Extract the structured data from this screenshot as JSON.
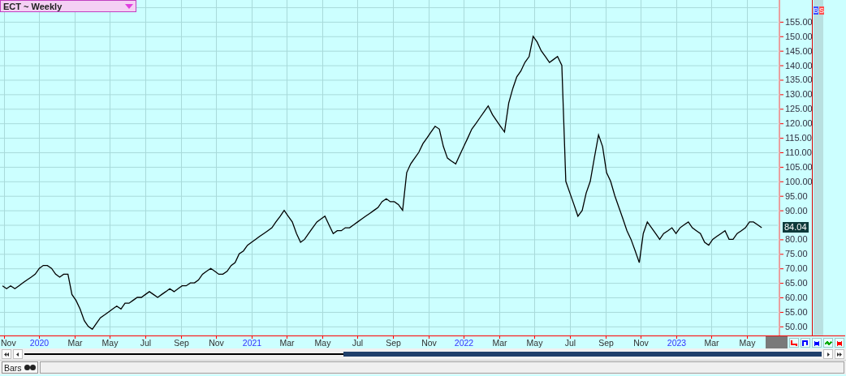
{
  "title_selector": {
    "label": "ECT ~ Weekly"
  },
  "chart": {
    "last_price": "84.04",
    "side_buttons": [
      {
        "label": "B",
        "kind": "buy"
      },
      {
        "label": "S",
        "kind": "sell"
      }
    ],
    "chart_data": {
      "type": "line",
      "grid": true,
      "ylim": [
        46.6,
        162.5
      ],
      "xlim": [
        2019.815,
        2023.801
      ],
      "yticks": [
        {
          "value": 50,
          "label": "50.00"
        },
        {
          "value": 55,
          "label": "55.00"
        },
        {
          "value": 60,
          "label": "60.00"
        },
        {
          "value": 65,
          "label": "65.00"
        },
        {
          "value": 70,
          "label": "70.00"
        },
        {
          "value": 75,
          "label": "75.00"
        },
        {
          "value": 80,
          "label": "80.00"
        },
        {
          "value": 90,
          "label": "90.00"
        },
        {
          "value": 95,
          "label": "95.00"
        },
        {
          "value": 100,
          "label": "100.00"
        },
        {
          "value": 105,
          "label": "105.00"
        },
        {
          "value": 110,
          "label": "110.00"
        },
        {
          "value": 115,
          "label": "115.00"
        },
        {
          "value": 120,
          "label": "120.00"
        },
        {
          "value": 125,
          "label": "125.00"
        },
        {
          "value": 130,
          "label": "130.00"
        },
        {
          "value": 135,
          "label": "135.00"
        },
        {
          "value": 140,
          "label": "140.00"
        },
        {
          "value": 145,
          "label": "145.00"
        },
        {
          "value": 150,
          "label": "150.00"
        },
        {
          "value": 155,
          "label": "155.00"
        }
      ],
      "xticks": [
        {
          "value": 2019.833,
          "label": "Nov"
        },
        {
          "value": 2020,
          "label": "2020"
        },
        {
          "value": 2020.167,
          "label": "Mar"
        },
        {
          "value": 2020.333,
          "label": "May"
        },
        {
          "value": 2020.5,
          "label": "Jul"
        },
        {
          "value": 2020.667,
          "label": "Sep"
        },
        {
          "value": 2020.833,
          "label": "Nov"
        },
        {
          "value": 2021,
          "label": "2021"
        },
        {
          "value": 2021.167,
          "label": "Mar"
        },
        {
          "value": 2021.333,
          "label": "May"
        },
        {
          "value": 2021.5,
          "label": "Jul"
        },
        {
          "value": 2021.667,
          "label": "Sep"
        },
        {
          "value": 2021.833,
          "label": "Nov"
        },
        {
          "value": 2022,
          "label": "2022"
        },
        {
          "value": 2022.167,
          "label": "Mar"
        },
        {
          "value": 2022.333,
          "label": "May"
        },
        {
          "value": 2022.5,
          "label": "Jul"
        },
        {
          "value": 2022.667,
          "label": "Sep"
        },
        {
          "value": 2022.833,
          "label": "Nov"
        },
        {
          "value": 2023,
          "label": "2023"
        },
        {
          "value": 2023.167,
          "label": "Mar"
        },
        {
          "value": 2023.333,
          "label": "May"
        }
      ],
      "x": [
        2019.827,
        2019.846,
        2019.865,
        2019.885,
        2019.904,
        2019.923,
        2019.942,
        2019.962,
        2019.981,
        2020.0,
        2020.019,
        2020.038,
        2020.058,
        2020.077,
        2020.096,
        2020.115,
        2020.135,
        2020.154,
        2020.173,
        2020.192,
        2020.212,
        2020.231,
        2020.25,
        2020.269,
        2020.288,
        2020.308,
        2020.327,
        2020.346,
        2020.365,
        2020.385,
        2020.404,
        2020.423,
        2020.442,
        2020.462,
        2020.481,
        2020.5,
        2020.519,
        2020.538,
        2020.558,
        2020.577,
        2020.596,
        2020.615,
        2020.635,
        2020.654,
        2020.673,
        2020.692,
        2020.712,
        2020.731,
        2020.75,
        2020.769,
        2020.788,
        2020.808,
        2020.827,
        2020.846,
        2020.865,
        2020.885,
        2020.904,
        2020.923,
        2020.942,
        2020.962,
        2020.981,
        2021.0,
        2021.019,
        2021.038,
        2021.058,
        2021.077,
        2021.096,
        2021.115,
        2021.135,
        2021.154,
        2021.173,
        2021.192,
        2021.212,
        2021.231,
        2021.25,
        2021.269,
        2021.288,
        2021.308,
        2021.327,
        2021.346,
        2021.365,
        2021.385,
        2021.404,
        2021.423,
        2021.442,
        2021.462,
        2021.481,
        2021.5,
        2021.519,
        2021.538,
        2021.558,
        2021.577,
        2021.596,
        2021.615,
        2021.635,
        2021.654,
        2021.673,
        2021.692,
        2021.712,
        2021.731,
        2021.75,
        2021.769,
        2021.788,
        2021.808,
        2021.827,
        2021.846,
        2021.865,
        2021.885,
        2021.904,
        2021.923,
        2021.942,
        2021.962,
        2021.981,
        2022.0,
        2022.019,
        2022.038,
        2022.058,
        2022.077,
        2022.096,
        2022.115,
        2022.135,
        2022.154,
        2022.173,
        2022.192,
        2022.212,
        2022.231,
        2022.25,
        2022.269,
        2022.288,
        2022.308,
        2022.327,
        2022.346,
        2022.365,
        2022.385,
        2022.404,
        2022.423,
        2022.442,
        2022.462,
        2022.481,
        2022.5,
        2022.519,
        2022.538,
        2022.558,
        2022.577,
        2022.596,
        2022.615,
        2022.635,
        2022.654,
        2022.673,
        2022.692,
        2022.712,
        2022.731,
        2022.75,
        2022.769,
        2022.788,
        2022.808,
        2022.827,
        2022.846,
        2022.865,
        2022.885,
        2022.904,
        2022.923,
        2022.942,
        2022.962,
        2022.981,
        2023.0,
        2023.019,
        2023.038,
        2023.058,
        2023.077,
        2023.096,
        2023.115,
        2023.135,
        2023.154,
        2023.173,
        2023.192,
        2023.212,
        2023.231,
        2023.25,
        2023.269,
        2023.288,
        2023.308,
        2023.327,
        2023.346,
        2023.365,
        2023.385,
        2023.404
      ],
      "series": [
        {
          "color": "#000000",
          "values": [
            64,
            63,
            64,
            63,
            64,
            65,
            66,
            67,
            68,
            70,
            71,
            71,
            70,
            68,
            67,
            68,
            68,
            61,
            59,
            56,
            52,
            50,
            49,
            51,
            53,
            54,
            55,
            56,
            57,
            56,
            58,
            58,
            59,
            60,
            60,
            61,
            62,
            61,
            60,
            61,
            62,
            63,
            62,
            63,
            64,
            64,
            65,
            65,
            66,
            68,
            69,
            70,
            69,
            68,
            68,
            69,
            71,
            72,
            75,
            76,
            78,
            79,
            80,
            81,
            82,
            83,
            84,
            86,
            88,
            90,
            88,
            86,
            82,
            79,
            80,
            82,
            84,
            86,
            87,
            88,
            85,
            82,
            83,
            83,
            84,
            84,
            85,
            86,
            87,
            88,
            89,
            90,
            91,
            93,
            94,
            93,
            93,
            92,
            90,
            103,
            106,
            108,
            110,
            113,
            115,
            117,
            119,
            118,
            112,
            108,
            107,
            106,
            109,
            112,
            115,
            118,
            120,
            122,
            124,
            126,
            123,
            121,
            119,
            117,
            127,
            132,
            136,
            138,
            141,
            143,
            150,
            148,
            145,
            143,
            141,
            142,
            143,
            140,
            100,
            96,
            92,
            88,
            90,
            96,
            100,
            108,
            116,
            112,
            103,
            100,
            95,
            91,
            87,
            83,
            80,
            76,
            72,
            82,
            86,
            84,
            82,
            80,
            82,
            83,
            84,
            82,
            84,
            85,
            86,
            84,
            83,
            82,
            79,
            78,
            80,
            81,
            82,
            83,
            80,
            80,
            82,
            83,
            84,
            86,
            86,
            85,
            84
          ]
        }
      ]
    }
  },
  "tool_buttons": [
    {
      "kind": "step-down",
      "color": "#ff0000"
    },
    {
      "kind": "step-up",
      "color": "#0000ff"
    },
    {
      "kind": "cross",
      "color": "#0000ff"
    },
    {
      "kind": "wave",
      "color": "#00aa00"
    },
    {
      "kind": "cross",
      "color": "#ff0000"
    }
  ],
  "scrollbar": {
    "level": 0.6
  },
  "status_bar": {
    "tabs": [
      {
        "label": "Bars",
        "selected": true
      }
    ]
  }
}
